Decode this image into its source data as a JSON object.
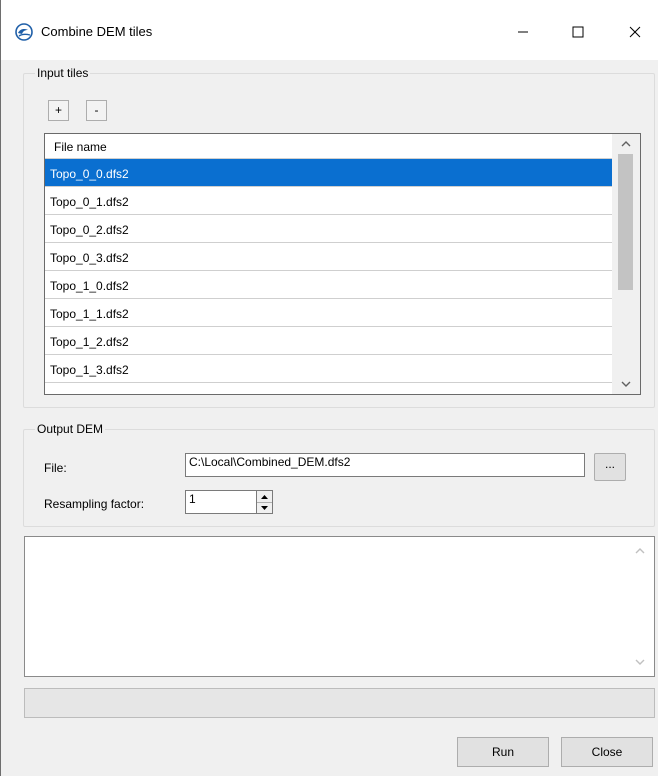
{
  "window": {
    "title": "Combine DEM tiles",
    "icon": "dhi-wave-icon"
  },
  "input_tiles": {
    "group_title": "Input tiles",
    "add_label": "+",
    "remove_label": "-",
    "column_header": "File name",
    "files": [
      "Topo_0_0.dfs2",
      "Topo_0_1.dfs2",
      "Topo_0_2.dfs2",
      "Topo_0_3.dfs2",
      "Topo_1_0.dfs2",
      "Topo_1_1.dfs2",
      "Topo_1_2.dfs2",
      "Topo_1_3.dfs2"
    ],
    "selected_index": 0
  },
  "output_dem": {
    "group_title": "Output DEM",
    "file_label": "File:",
    "file_value": "C:\\Local\\Combined_DEM.dfs2",
    "browse_label": "...",
    "resampling_label": "Resampling factor:",
    "resampling_value": "1"
  },
  "log": {
    "text": ""
  },
  "progress": {
    "value": 0
  },
  "buttons": {
    "run": "Run",
    "close": "Close"
  },
  "colors": {
    "selection": "#0a6fd0",
    "window_bg": "#f0f0f0"
  }
}
